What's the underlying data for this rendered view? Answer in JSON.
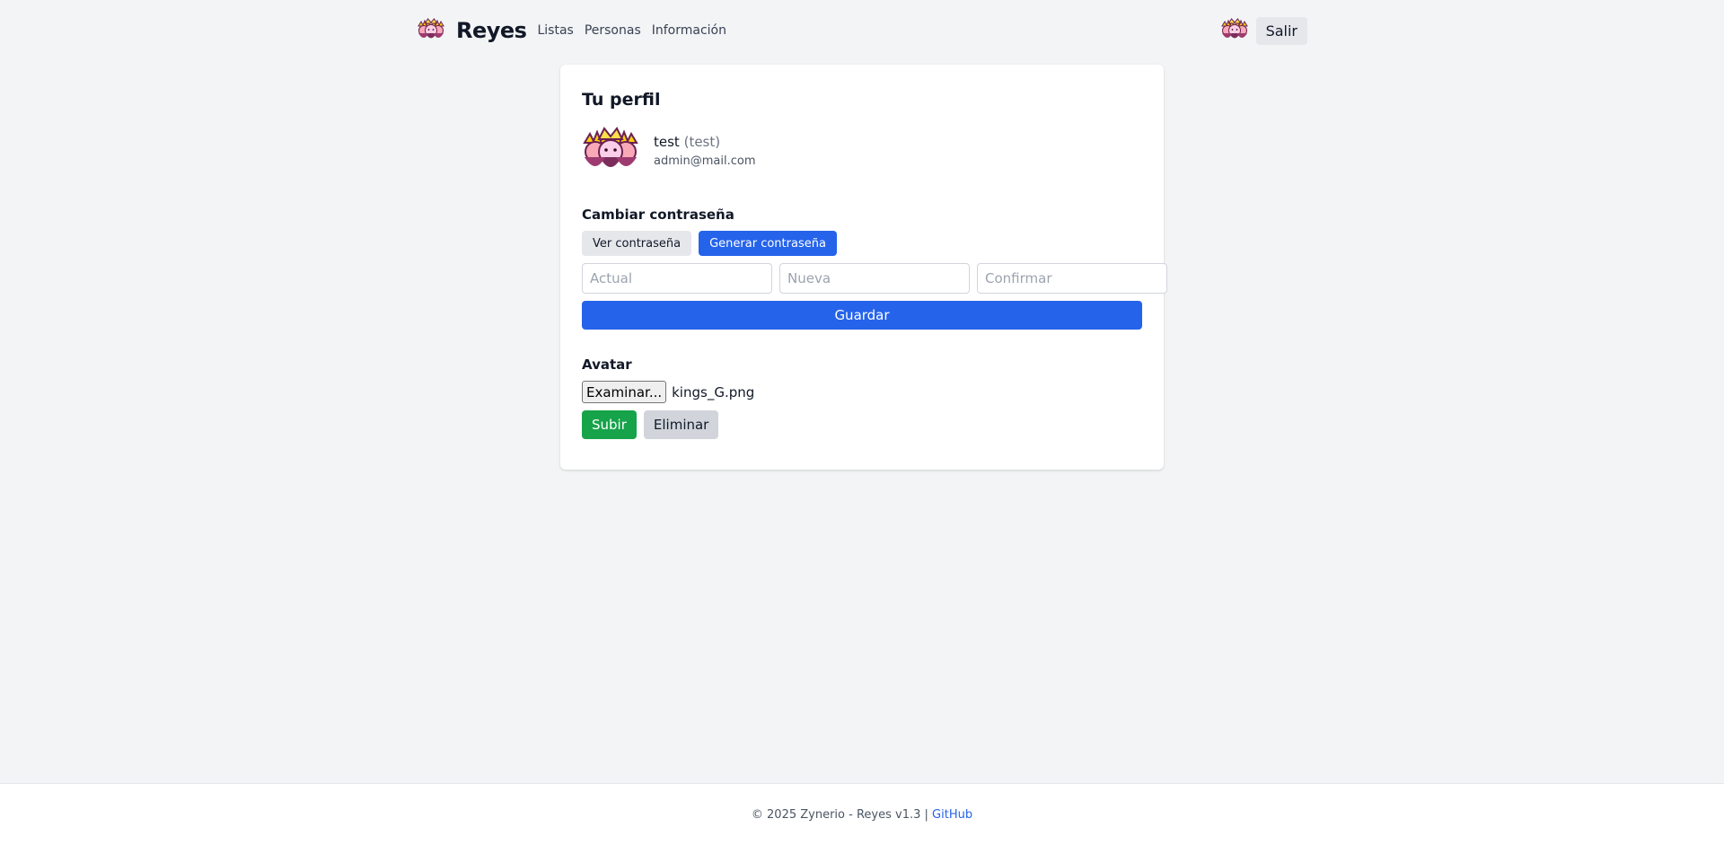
{
  "header": {
    "brand": "Reyes",
    "nav": [
      "Listas",
      "Personas",
      "Información"
    ],
    "logout_label": "Salir",
    "logo_icon": "three-kings-icon"
  },
  "profile": {
    "title": "Tu perfil",
    "name": "test",
    "username": "(test)",
    "email": "admin@mail.com",
    "avatar_icon": "three-kings-icon"
  },
  "password": {
    "title": "Cambiar contraseña",
    "show_label": "Ver contraseña",
    "generate_label": "Generar contraseña",
    "current_placeholder": "Actual",
    "new_placeholder": "Nueva",
    "confirm_placeholder": "Confirmar",
    "save_label": "Guardar"
  },
  "avatar": {
    "title": "Avatar",
    "browse_label": "Examinar...",
    "file_name": "kings_G.png",
    "upload_label": "Subir",
    "delete_label": "Eliminar"
  },
  "footer": {
    "text": "© 2025 Zynerio - Reyes v1.3 | ",
    "link": "GitHub"
  },
  "colors": {
    "primary": "#2563eb",
    "success": "#16a34a",
    "background": "#f3f4f6"
  }
}
